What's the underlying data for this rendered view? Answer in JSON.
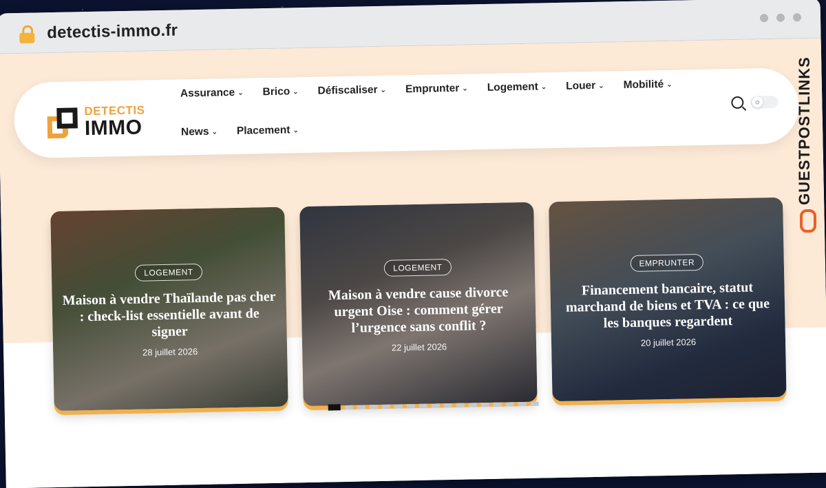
{
  "browser": {
    "url": "detectis-immo.fr"
  },
  "logo": {
    "top": "DETECTIS",
    "bottom": "IMMO"
  },
  "nav": {
    "items": [
      {
        "label": "Assurance"
      },
      {
        "label": "Brico"
      },
      {
        "label": "Défiscaliser"
      },
      {
        "label": "Emprunter"
      },
      {
        "label": "Logement"
      },
      {
        "label": "Louer"
      },
      {
        "label": "Mobilité"
      },
      {
        "label": "News"
      },
      {
        "label": "Placement"
      }
    ]
  },
  "slides": [
    {
      "category": "LOGEMENT",
      "title": "Maison à vendre Thaïlande pas cher : check-list essentielle avant de signer",
      "date": "28 juillet 2026"
    },
    {
      "category": "LOGEMENT",
      "title": "Maison à vendre cause divorce urgent Oise : comment gérer l’urgence sans conflit ?",
      "date": "22 juillet 2026"
    },
    {
      "category": "EMPRUNTER",
      "title": "Financement bancaire, statut marchand de biens et TVA : ce que les banques regardent",
      "date": "20 juillet 2026"
    }
  ],
  "pager": {
    "total": 17,
    "active": 1
  },
  "watermark": {
    "text": "GUESTPOSTLINKS"
  },
  "colors": {
    "accent": "#f0a23a",
    "hero_bg": "#fce9d6",
    "watermark_icon": "#e8602c"
  }
}
